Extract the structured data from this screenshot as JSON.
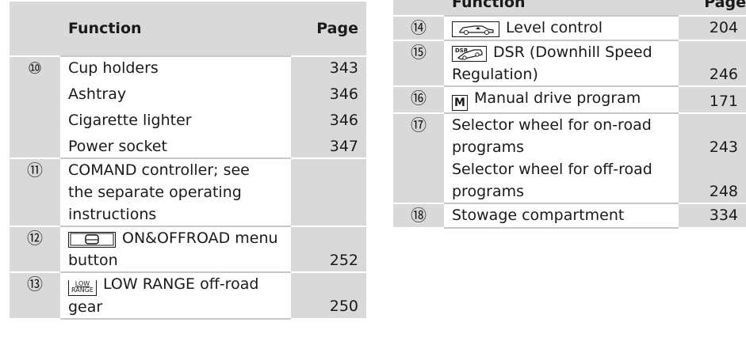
{
  "left": {
    "header": {
      "function": "Function",
      "page": "Page"
    },
    "rows": [
      {
        "num": "⑩",
        "lines": [
          "Cup holders",
          "Ashtray",
          "Cigarette lighter",
          "Power socket"
        ],
        "pages": [
          "343",
          "346",
          "346",
          "347"
        ]
      },
      {
        "num": "⑪",
        "lines": [
          "COMAND controller; see",
          "the separate operating",
          "instructions"
        ],
        "pages": []
      },
      {
        "num": "⑫",
        "icon": "menu-button-icon",
        "lines": [
          "ON&OFFROAD menu",
          "button"
        ],
        "pages": [
          "252"
        ]
      },
      {
        "num": "⑬",
        "icon": "low-range-icon",
        "icon_text": [
          "LOW",
          "RANGE"
        ],
        "lines": [
          "LOW RANGE off-road",
          "gear"
        ],
        "pages": [
          "250"
        ]
      }
    ]
  },
  "right": {
    "header": {
      "function": "Function",
      "page": "Page"
    },
    "rows": [
      {
        "num": "⑭",
        "icon": "level-control-icon",
        "lines": [
          "Level control"
        ],
        "pages": [
          "204"
        ]
      },
      {
        "num": "⑮",
        "icon": "dsr-icon",
        "icon_text": "DSR",
        "lines": [
          "DSR (Downhill Speed",
          "Regulation)"
        ],
        "pages": [
          "246"
        ]
      },
      {
        "num": "⑯",
        "icon": "manual-program-icon",
        "icon_text": "M",
        "lines": [
          "Manual drive program"
        ],
        "pages": [
          "171"
        ]
      },
      {
        "num": "⑰",
        "lines": [
          "Selector wheel for on-road",
          "programs",
          "Selector wheel for off-road",
          "programs"
        ],
        "pages": [
          "243",
          "248"
        ]
      },
      {
        "num": "⑱",
        "lines": [
          "Stowage compartment"
        ],
        "pages": [
          "334"
        ]
      }
    ]
  }
}
